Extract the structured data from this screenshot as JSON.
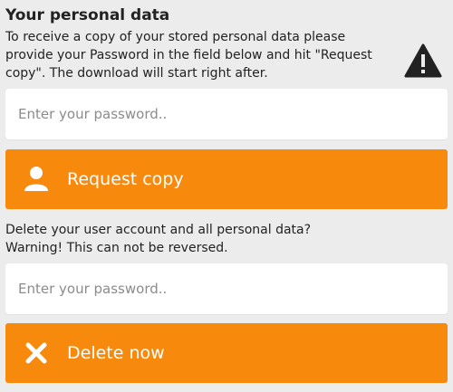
{
  "export_section": {
    "title": "Your personal data",
    "description": "To receive a copy of your stored personal data please provide your Password in the field below and hit \"Request copy\". The download will start right after.",
    "password_placeholder": "Enter your password..",
    "button_label": "Request copy",
    "button_icon": "user-icon",
    "warning_icon": "warning-icon"
  },
  "delete_section": {
    "line1": "Delete your user account and all personal data?",
    "line2": "Warning! This can not be reversed.",
    "password_placeholder": "Enter your password..",
    "button_label": "Delete now",
    "button_icon": "close-icon"
  },
  "colors": {
    "accent": "#f7890c",
    "background": "#ececec",
    "field_background": "#ffffff",
    "text": "#222222",
    "placeholder": "#8c8c8c"
  }
}
